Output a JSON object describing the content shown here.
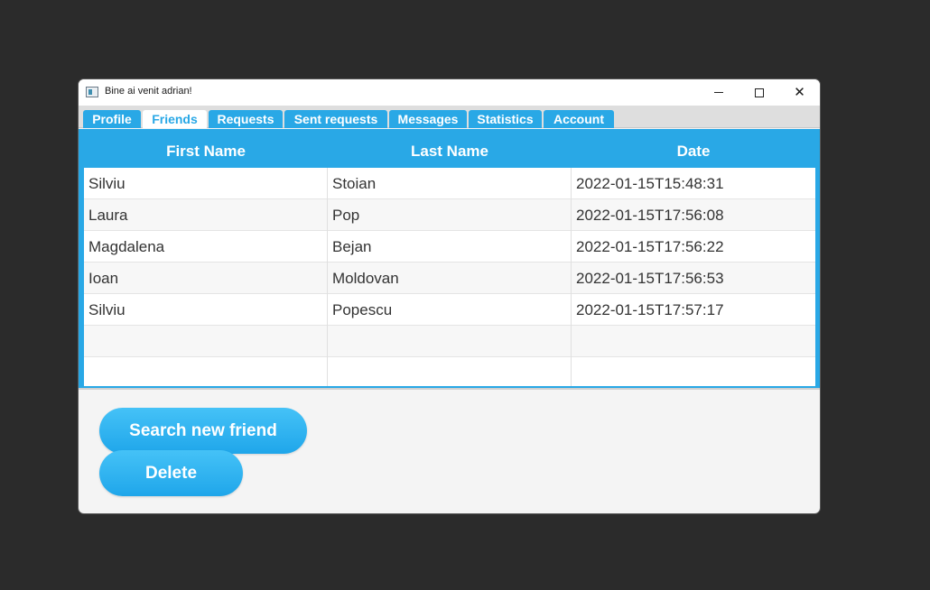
{
  "window": {
    "title": "Bine ai venit adrian!",
    "controls": {
      "minimize": "minimize-icon",
      "maximize": "maximize-icon",
      "close": "close-icon"
    }
  },
  "tabs": [
    {
      "label": "Profile",
      "active": false
    },
    {
      "label": "Friends",
      "active": true
    },
    {
      "label": "Requests",
      "active": false
    },
    {
      "label": "Sent requests",
      "active": false
    },
    {
      "label": "Messages",
      "active": false
    },
    {
      "label": "Statistics",
      "active": false
    },
    {
      "label": "Account",
      "active": false
    }
  ],
  "table": {
    "columns": [
      "First Name",
      "Last Name",
      "Date"
    ],
    "rows": [
      [
        "Silviu",
        "Stoian",
        "2022-01-15T15:48:31"
      ],
      [
        "Laura",
        "Pop",
        "2022-01-15T17:56:08"
      ],
      [
        "Magdalena",
        "Bejan",
        "2022-01-15T17:56:22"
      ],
      [
        "Ioan",
        "Moldovan",
        "2022-01-15T17:56:53"
      ],
      [
        "Silviu",
        "Popescu",
        "2022-01-15T17:57:17"
      ],
      [
        "",
        "",
        ""
      ],
      [
        "",
        "",
        ""
      ]
    ]
  },
  "actions": {
    "search_label": "Search new friend",
    "delete_label": "Delete"
  },
  "colors": {
    "accent": "#29a8e6",
    "background": "#2b2b2b",
    "panel": "#f4f4f4"
  }
}
